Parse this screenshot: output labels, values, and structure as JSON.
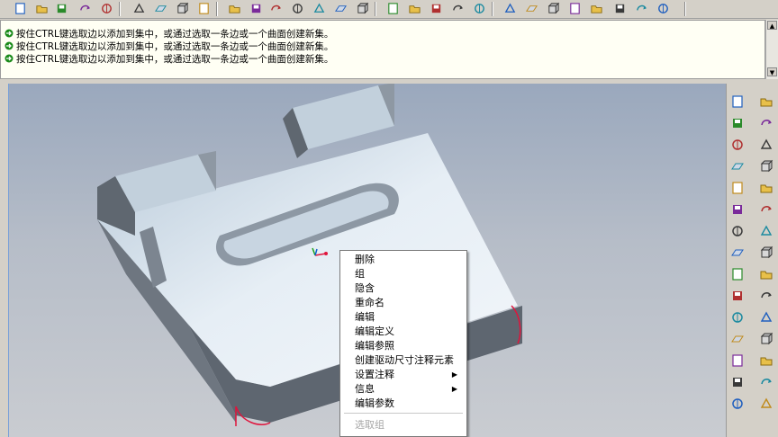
{
  "toolbar": {
    "icons": [
      "new-file-icon",
      "open-folder-icon",
      "open-recent-icon",
      "save-icon",
      "save-copy-icon",
      "undo-icon",
      "copy-icon",
      "paste-icon",
      "regenerate-icon",
      "repaint-icon",
      "select-icon",
      "zoom-icon",
      "spin-center-icon",
      "orient-icon",
      "layers-icon",
      "view-manager-icon",
      "wireframe-icon",
      "hidden-line-icon",
      "no-hidden-icon",
      "shaded-icon",
      "appearance-icon",
      "datum-planes-icon",
      "datum-axes-icon",
      "datum-curves-icon",
      "datum-points-icon",
      "csys-icon",
      "plane-display-icon",
      "axis-display-icon",
      "point-display-icon"
    ]
  },
  "messages": [
    {
      "text": "按住CTRL键选取边以添加到集中，或通过选取一条边或一个曲面创建新集。"
    },
    {
      "text": "按住CTRL键选取边以添加到集中，或通过选取一条边或一个曲面创建新集。"
    },
    {
      "text": "按住CTRL键选取边以添加到集中，或通过选取一条边或一个曲面创建新集。"
    }
  ],
  "context_menu": {
    "items": [
      {
        "label": "删除",
        "disabled": false,
        "submenu": false
      },
      {
        "label": "组",
        "disabled": false,
        "submenu": false
      },
      {
        "label": "隐含",
        "disabled": false,
        "submenu": false
      },
      {
        "label": "重命名",
        "disabled": false,
        "submenu": false
      },
      {
        "label": "编辑",
        "disabled": false,
        "submenu": false
      },
      {
        "label": "编辑定义",
        "disabled": false,
        "submenu": false
      },
      {
        "label": "编辑参照",
        "disabled": false,
        "submenu": false
      },
      {
        "label": "创建驱动尺寸注释元素",
        "disabled": false,
        "submenu": false
      },
      {
        "label": "设置注释",
        "disabled": false,
        "submenu": true
      },
      {
        "label": "信息",
        "disabled": false,
        "submenu": true
      },
      {
        "label": "编辑参数",
        "disabled": false,
        "submenu": false
      },
      {
        "label": "选取组",
        "disabled": true,
        "submenu": false
      }
    ]
  },
  "right_toolbar": {
    "icons": [
      "sketch-icon",
      "brush-icon",
      "datum-plane-icon",
      "color-icon",
      "datum-axis-icon",
      "apply-icon",
      "curve-icon",
      "cut-icon",
      "point-icon",
      "draft-icon",
      "csys-icon",
      "shell-icon",
      "annotation-icon",
      "rib-icon",
      "hole-icon",
      "round-icon",
      "chamfer-icon",
      "pattern-icon",
      "mirror-icon",
      "merge-icon",
      "trim-icon",
      "extend-icon",
      "offset-icon",
      "thicken-icon",
      "solidify-icon",
      "project-icon",
      "intersect-icon",
      "wrap-icon",
      "fill-icon",
      "blend-icon"
    ]
  },
  "colors": {
    "model_top": "#d7e3ee",
    "model_side": "#5f6770",
    "model_front": "#7f8893",
    "highlight": "#e0143c",
    "message_bg": "#fffff4"
  }
}
